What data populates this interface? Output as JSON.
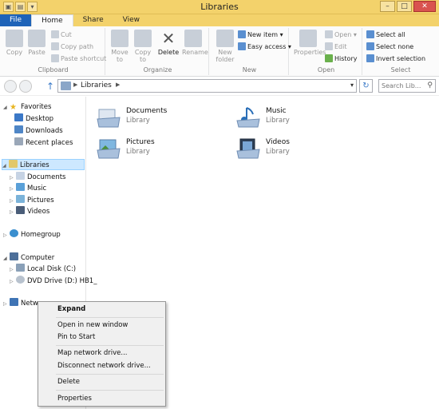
{
  "window": {
    "title": "Libraries"
  },
  "tabs": {
    "file": "File",
    "home": "Home",
    "share": "Share",
    "view": "View"
  },
  "ribbon": {
    "clipboard": {
      "label": "Clipboard",
      "copy": "Copy",
      "paste": "Paste",
      "cut": "Cut",
      "copy_path": "Copy path",
      "paste_shortcut": "Paste shortcut"
    },
    "organize": {
      "label": "Organize",
      "move_to": "Move to",
      "copy_to": "Copy to",
      "delete": "Delete",
      "rename": "Rename"
    },
    "new": {
      "label": "New",
      "new_folder": "New folder",
      "new_item": "New item",
      "easy_access": "Easy access"
    },
    "open": {
      "label": "Open",
      "properties": "Properties",
      "open": "Open",
      "edit": "Edit",
      "history": "History"
    },
    "select": {
      "label": "Select",
      "select_all": "Select all",
      "select_none": "Select none",
      "invert": "Invert selection"
    }
  },
  "address": {
    "path": "Libraries",
    "search_placeholder": "Search Lib..."
  },
  "nav": {
    "favorites": "Favorites",
    "desktop": "Desktop",
    "downloads": "Downloads",
    "recent": "Recent places",
    "libraries": "Libraries",
    "documents": "Documents",
    "music": "Music",
    "pictures": "Pictures",
    "videos": "Videos",
    "homegroup": "Homegroup",
    "computer": "Computer",
    "local_disk": "Local Disk (C:)",
    "dvd": "DVD Drive (D:) HB1_",
    "network": "Netwo"
  },
  "content": [
    {
      "name": "Documents",
      "sub": "Library"
    },
    {
      "name": "Music",
      "sub": "Library"
    },
    {
      "name": "Pictures",
      "sub": "Library"
    },
    {
      "name": "Videos",
      "sub": "Library"
    }
  ],
  "menu": {
    "expand": "Expand",
    "open_new_window": "Open in new window",
    "pin_start": "Pin to Start",
    "map_drive": "Map network drive...",
    "disconnect_drive": "Disconnect network drive...",
    "delete": "Delete",
    "properties": "Properties"
  }
}
